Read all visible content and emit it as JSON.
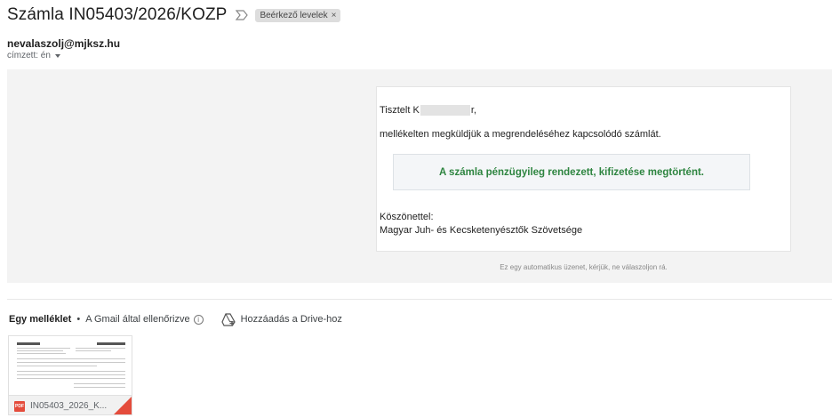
{
  "email": {
    "subject": "Számla IN05403/2026/KOZP",
    "label_chip": "Beérkező levelek",
    "label_remove": "×",
    "sender": "nevalaszolj@mjksz.hu",
    "recipient": "címzett: én"
  },
  "body": {
    "greeting_start": "Tisztelt K",
    "greeting_end": "r,",
    "intro": "mellékelten megküldjük a megrendeléséhez kapcsolódó számlát.",
    "paid_notice": "A számla pénzügyileg rendezett, kifizetése megtörtént.",
    "paid_color": "#2e8540",
    "thanks": "Köszönettel:",
    "organization": "Magyar Juh- és Kecsketenyésztők Szövetsége",
    "auto_note": "Ez egy automatikus üzenet, kérjük, ne válaszoljon rá."
  },
  "attachments": {
    "count_label": "Egy melléklet",
    "scan_label": "A Gmail által ellenőrizve",
    "drive_label": "Hozzáadás a Drive-hoz",
    "file": {
      "name": "IN05403_2026_K...",
      "type_badge": "PDF"
    }
  },
  "icons": {
    "important": "important-marker-icon",
    "info": "info-icon",
    "drive": "add-to-drive-icon",
    "pdf": "pdf-icon"
  }
}
